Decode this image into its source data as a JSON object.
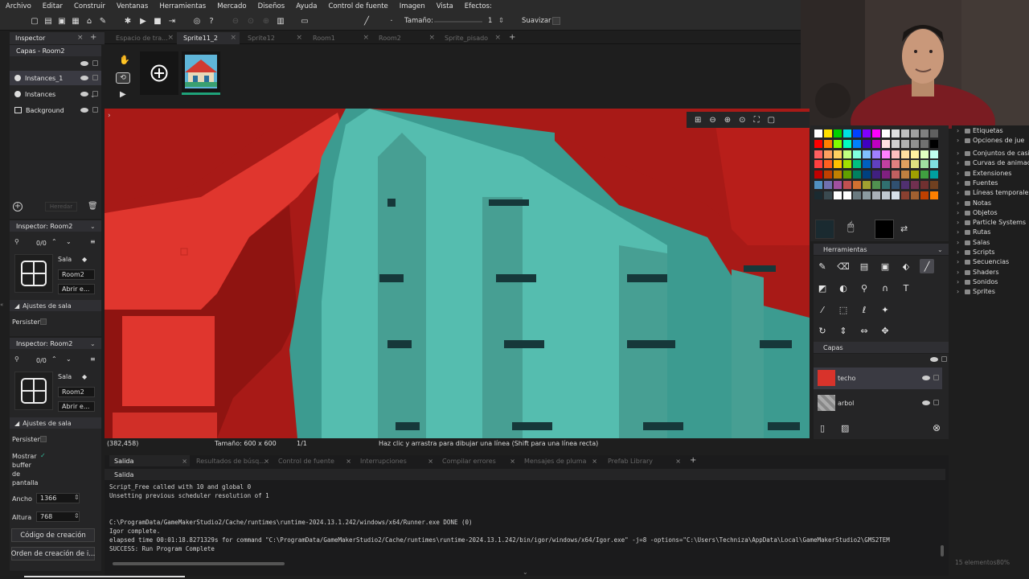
{
  "menu": [
    "Archivo",
    "Editar",
    "Construir",
    "Ventanas",
    "Herramientas",
    "Mercado",
    "Diseños",
    "Ayuda",
    "Control de fuente",
    "Imagen",
    "Vista",
    "Efectos:"
  ],
  "toolbar": {
    "size_label": "Tamaño:",
    "size_value": "1",
    "smooth_label": "Suavizar"
  },
  "tabs": [
    {
      "label": "Inspector",
      "active": true
    },
    {
      "label": "Espacio de tra...",
      "active": false
    },
    {
      "label": "Sprite11_2",
      "active": true
    },
    {
      "label": "Sprite12",
      "active": false
    },
    {
      "label": "Room1",
      "active": false
    },
    {
      "label": "Room2",
      "active": false
    },
    {
      "label": "Sprite_pisado",
      "active": false
    }
  ],
  "layers_panel": {
    "title": "Capas - Room2",
    "items": [
      {
        "label": "Instances_1",
        "selected": true
      },
      {
        "label": "Instances",
        "selected": false
      },
      {
        "label": "Background",
        "selected": false
      }
    ],
    "inherit_label": "Heredar"
  },
  "inspector1": {
    "title": "Inspector: Room2",
    "count": "0/0",
    "type_label": "Sala",
    "name": "Room2",
    "open_label": "Abrir e...",
    "section": "Ajustes de sala",
    "persistent_label": "Persisten"
  },
  "inspector2": {
    "title": "Inspector: Room2",
    "count": "0/0",
    "type_label": "Sala",
    "name": "Room2",
    "open_label": "Abrir e...",
    "section": "Ajustes de sala",
    "persistent_label": "Persisten",
    "show_buffer_label": "Mostrar buffer de pantalla",
    "width_label": "Ancho",
    "width_value": "1366",
    "height_label": "Altura",
    "height_value": "768",
    "creation_code_label": "Código de creación",
    "creation_order_label": "Orden de creación de i..."
  },
  "status": {
    "coords": "(382,458)",
    "size": "Tamaño: 600 x 600",
    "frame": "1/1",
    "hint": "Haz clic y arrastra para dibujar una línea (Shift para una línea recta)"
  },
  "palette": [
    "#ffffff",
    "#ffe000",
    "#00d000",
    "#00e0e0",
    "#0040ff",
    "#8000ff",
    "#ff00ff",
    "#ffffff",
    "#e0e0e0",
    "#c0c0c0",
    "#a0a0a0",
    "#808080",
    "#606060",
    "#ff0000",
    "#ff8000",
    "#80ff00",
    "#00ffc0",
    "#0080ff",
    "#4000c0",
    "#c000c0",
    "#ffe0e0",
    "#d0d0d0",
    "#b0b0b0",
    "#909090",
    "#707070",
    "#000000",
    "#ff6060",
    "#ffa060",
    "#ffd060",
    "#c0ff80",
    "#80ffe0",
    "#80c0ff",
    "#a080ff",
    "#ff80ff",
    "#ffc0c0",
    "#ffe0a0",
    "#fff0a0",
    "#e0ffc0",
    "#c0fff0",
    "#ff4040",
    "#ff6020",
    "#ffc000",
    "#a0e000",
    "#00c080",
    "#0060c0",
    "#6040c0",
    "#c040a0",
    "#e08080",
    "#e0a060",
    "#e0e080",
    "#a0e0a0",
    "#80e0e0",
    "#c00000",
    "#c04000",
    "#c08000",
    "#60a000",
    "#008060",
    "#004080",
    "#402080",
    "#802080",
    "#c06060",
    "#c08040",
    "#a0a000",
    "#40a040",
    "#00a0a0",
    "#5090c0",
    "#7070b0",
    "#a050a0",
    "#c05050",
    "#d07030",
    "#a0a030",
    "#509050",
    "#307070",
    "#305070",
    "#503070",
    "#703050",
    "#703030",
    "#704020",
    "#1a2a30",
    "#3a4a50",
    "#ffffff",
    "#ffffff",
    "#6a7a80",
    "#8a9aa0",
    "#aab0b8",
    "#c0c8d0",
    "#d8e0e8",
    "#8a4030",
    "#a06030",
    "#c04000",
    "#ff8000"
  ],
  "tools_panel": {
    "title": "Herramientas"
  },
  "capas_panel": {
    "title": "Capas",
    "layers": [
      "techo",
      "arbol"
    ]
  },
  "assets": [
    "Etiquetas",
    "Opciones de jue",
    "Conjuntos de casillas",
    "Curvas de animación",
    "Extensiones",
    "Fuentes",
    "Líneas temporales",
    "Notas",
    "Objetos",
    "Particle Systems",
    "Rutas",
    "Salas",
    "Scripts",
    "Secuencias",
    "Shaders",
    "Sonidos",
    "Sprites"
  ],
  "assets_footer": "15 elementos",
  "zoom": "80%",
  "output": {
    "tabs": [
      "Salida",
      "Resultados de búsq...",
      "Control de fuente",
      "Interrupciones",
      "Compilar errores",
      "Mensajes de pluma",
      "Prefab Library"
    ],
    "header": "Salida",
    "lines": [
      "Script_Free called with 10 and global 0",
      "Unsetting previous scheduler resolution of 1",
      "",
      "",
      "C:\\ProgramData/GameMakerStudio2/Cache/runtimes\\runtime-2024.13.1.242/windows/x64/Runner.exe DONE (0)",
      "Igor complete.",
      "elapsed time 00:01:18.8271329s for command \"C:\\ProgramData/GameMakerStudio2/Cache/runtimes\\runtime-2024.13.1.242/bin/igor/windows/x64/Igor.exe\" -j=8  -options=\"C:\\Users\\Techniza\\AppData\\Local\\GameMakerStudio2\\GMS2TEM",
      "SUCCESS: Run Program Complete"
    ]
  },
  "colors": {
    "roof_red": "#d8332b",
    "roof_dark": "#8a1512",
    "tree_teal": "#42a89c",
    "tree_light": "#57bfb0",
    "bg": "#1e1e1e",
    "accent": "#3b73b9"
  }
}
